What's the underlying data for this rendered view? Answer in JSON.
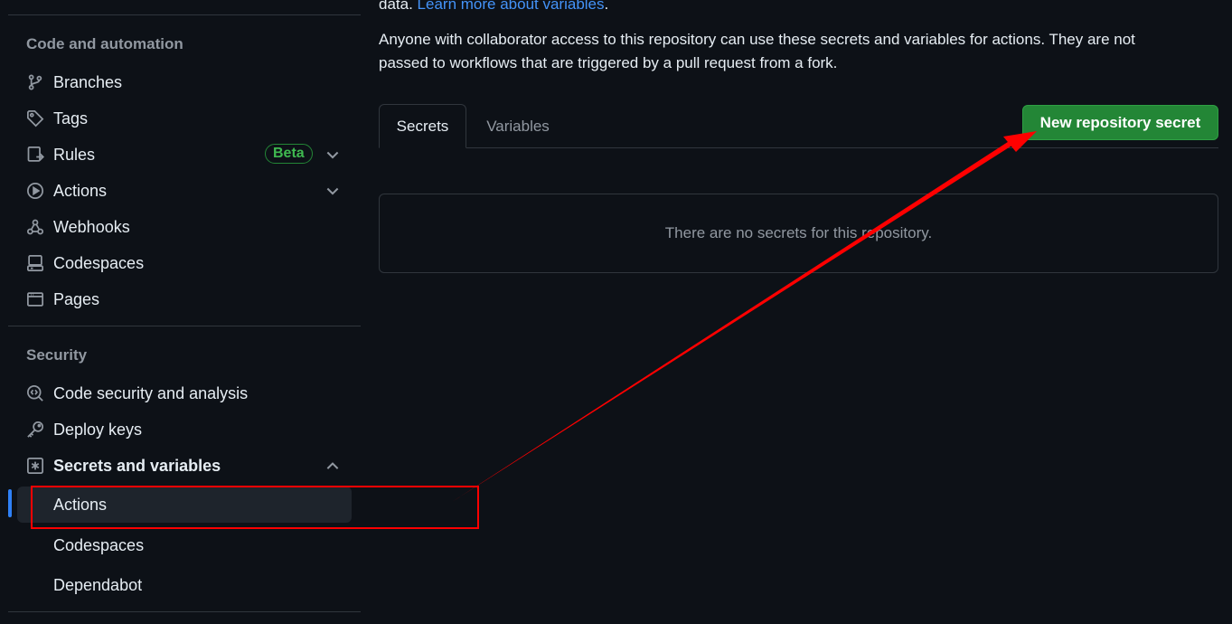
{
  "sidebar": {
    "code_section_title": "Code and automation",
    "code_items": [
      {
        "label": "Branches",
        "icon": "branch-icon"
      },
      {
        "label": "Tags",
        "icon": "tag-icon"
      },
      {
        "label": "Rules",
        "icon": "rules-icon",
        "badge": "Beta"
      },
      {
        "label": "Actions",
        "icon": "play-icon"
      },
      {
        "label": "Webhooks",
        "icon": "webhook-icon"
      },
      {
        "label": "Codespaces",
        "icon": "codespaces-icon"
      },
      {
        "label": "Pages",
        "icon": "browser-icon"
      }
    ],
    "security_section_title": "Security",
    "security_items": [
      {
        "label": "Code security and analysis",
        "icon": "codescan-icon"
      },
      {
        "label": "Deploy keys",
        "icon": "key-icon"
      },
      {
        "label": "Secrets and variables",
        "icon": "asterisk-icon"
      }
    ],
    "secrets_sub_items": [
      {
        "label": "Actions",
        "active": true
      },
      {
        "label": "Codespaces"
      },
      {
        "label": "Dependabot"
      }
    ]
  },
  "main": {
    "intro_prefix": "data.",
    "intro_link": "Learn more about variables",
    "intro_suffix": ".",
    "description_line1": "Anyone with collaborator access to this repository can use these secrets and variables for actions. They are not",
    "description_line2": "passed to workflows that are triggered by a pull request from a fork.",
    "tabs": [
      {
        "label": "Secrets",
        "selected": true
      },
      {
        "label": "Variables"
      }
    ],
    "new_secret_button": "New repository secret",
    "empty_message": "There are no secrets for this repository."
  },
  "annotation": {
    "color": "#ff0000"
  }
}
